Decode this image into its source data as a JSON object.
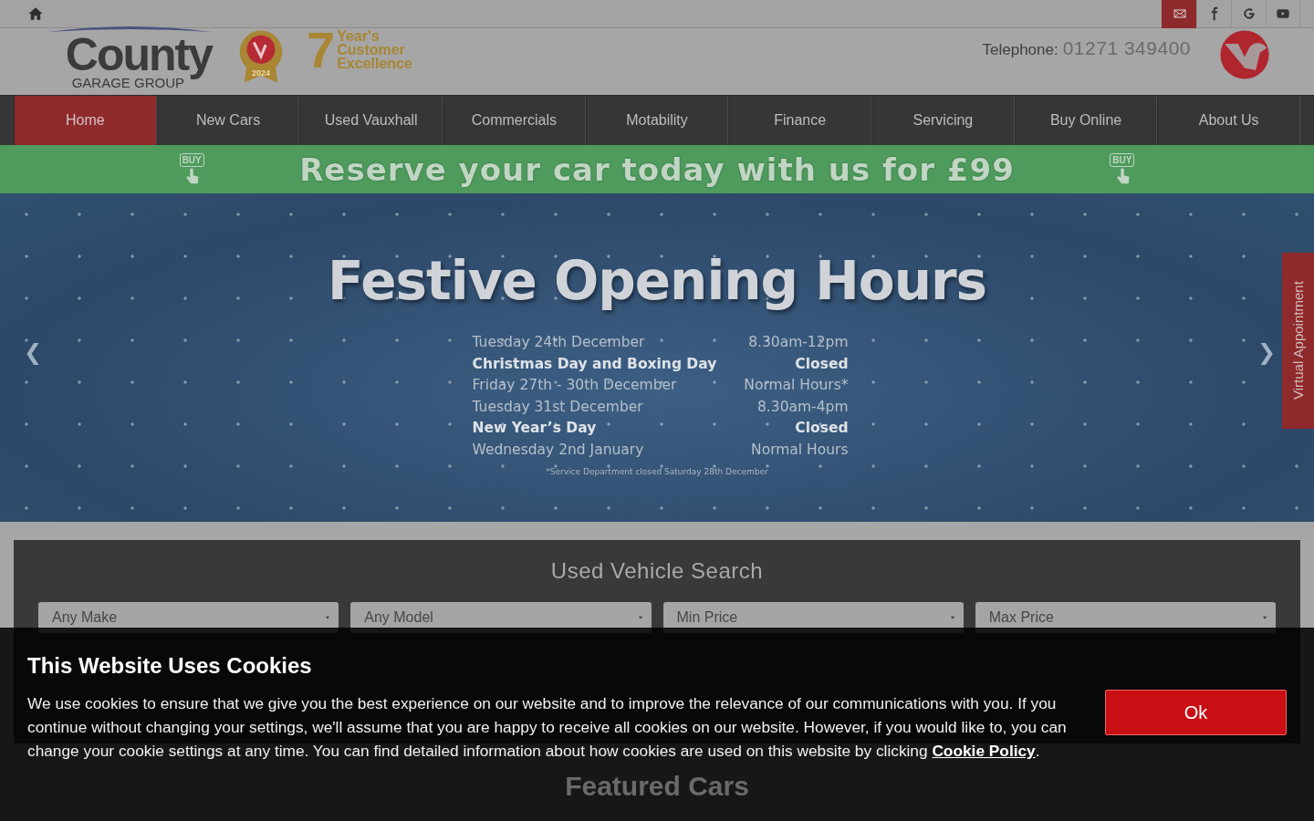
{
  "top_bar": {
    "social": [
      {
        "kind": "mail",
        "selected": true
      },
      {
        "kind": "facebook",
        "selected": false
      },
      {
        "kind": "google",
        "selected": false
      },
      {
        "kind": "youtube",
        "selected": false
      }
    ]
  },
  "header": {
    "logo": {
      "name": "County",
      "tagline": "GARAGE GROUP"
    },
    "award": {
      "year": "2024",
      "number": "7",
      "lines": [
        "Year's",
        "Customer",
        "Excellence"
      ]
    },
    "phone_label": "Telephone:",
    "phone": "01271 349400"
  },
  "nav": [
    {
      "label": "Home",
      "selected": true
    },
    {
      "label": "New Cars",
      "selected": false
    },
    {
      "label": "Used Vauxhall",
      "selected": false
    },
    {
      "label": "Commercials",
      "selected": false
    },
    {
      "label": "Motability",
      "selected": false
    },
    {
      "label": "Finance",
      "selected": false
    },
    {
      "label": "Servicing",
      "selected": false
    },
    {
      "label": "Buy Online",
      "selected": false
    },
    {
      "label": "About Us",
      "selected": false
    }
  ],
  "promo": {
    "text": "Reserve your car today with us for £99",
    "badges": [
      "BUY",
      "BUY"
    ]
  },
  "hero": {
    "prev": "❮",
    "next": "❯",
    "title": "Festive Opening Hours",
    "rows": [
      {
        "day": "Tuesday 24th December",
        "hours": "8.30am-12pm",
        "emphasis": false
      },
      {
        "day": "Christmas Day and Boxing Day",
        "hours": "Closed",
        "emphasis": true
      },
      {
        "day": "Friday 27th - 30th December",
        "hours": "Normal Hours*",
        "emphasis": false
      },
      {
        "day": "Tuesday 31st December",
        "hours": "8.30am-4pm",
        "emphasis": false
      },
      {
        "day": "New Year’s Day",
        "hours": "Closed",
        "emphasis": true
      },
      {
        "day": "Wednesday 2nd January",
        "hours": "Normal Hours",
        "emphasis": false
      }
    ],
    "footnote": "*Service Department closed Saturday 28th December",
    "side_tab": "Virtual Appointment"
  },
  "search": {
    "title": "Used Vehicle Search",
    "fields": [
      {
        "kind": "select",
        "placeholder": "Any Make"
      },
      {
        "kind": "select",
        "placeholder": "Any Model"
      },
      {
        "kind": "select",
        "placeholder": "Min Price"
      },
      {
        "kind": "select",
        "placeholder": "Max Price"
      }
    ]
  },
  "featured": {
    "title": "Featured Cars"
  },
  "cookie": {
    "title": "This Website Uses Cookies",
    "text": "We use cookies to ensure that we give you the best experience on our website and to improve the relevance of our communications with you. If you continue without changing your settings, we'll assume that you are happy to receive all cookies on our website. However, if you would like to, you can change your cookie settings at any time. You can find detailed information about how cookies are used on this website by clicking",
    "link": "Cookie Policy",
    "end": ".",
    "button": "Ok"
  }
}
